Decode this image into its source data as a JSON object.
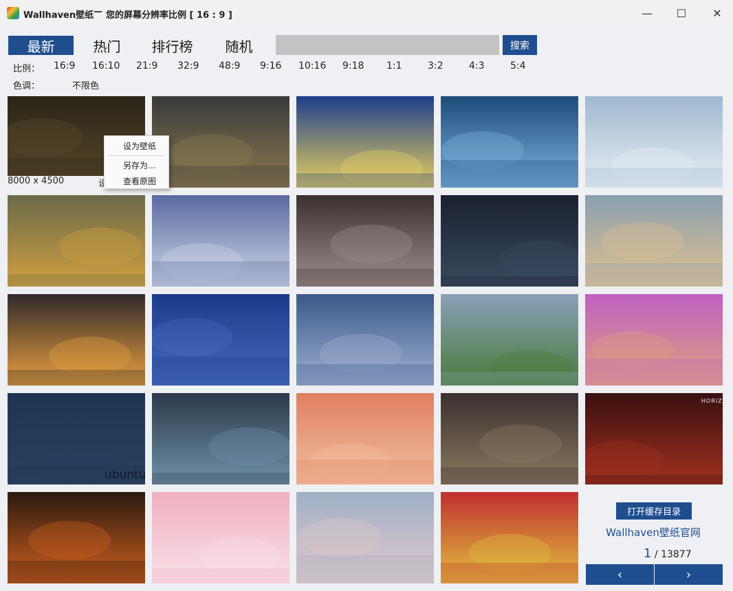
{
  "window": {
    "app_name": "Wallhaven壁纸",
    "separator": "—",
    "subtitle": "您的屏幕分辨率比例 [ 16 : 9 ]",
    "minimize_glyph": "—",
    "maximize_glyph": "☐",
    "close_glyph": "✕"
  },
  "nav": {
    "tabs": [
      {
        "label": "最新",
        "active": true
      },
      {
        "label": "热门",
        "active": false
      },
      {
        "label": "排行榜",
        "active": false
      },
      {
        "label": "随机",
        "active": false
      }
    ]
  },
  "search": {
    "placeholder": "",
    "button_label": "搜索"
  },
  "filters": {
    "ratio_label": "比例：",
    "ratios": [
      "16:9",
      "16:10",
      "21:9",
      "32:9",
      "48:9",
      "9:16",
      "10:16",
      "9:18",
      "1:1",
      "3:2",
      "4:3",
      "5:4"
    ],
    "color_label": "色调：",
    "color_value": "不限色"
  },
  "thumbnails": [
    {
      "name": "dark-warriors",
      "colors": [
        "#2a2418",
        "#5a4a2a"
      ]
    },
    {
      "name": "sunset-clouds",
      "colors": [
        "#3a3a3a",
        "#8a7a50"
      ]
    },
    {
      "name": "starry-wave",
      "colors": [
        "#1d3f8a",
        "#e8d060"
      ]
    },
    {
      "name": "car-snow-road",
      "colors": [
        "#1c4b7a",
        "#7fb4e0"
      ]
    },
    {
      "name": "car-snow-forest",
      "colors": [
        "#9fb8d0",
        "#e8eef4"
      ]
    },
    {
      "name": "car-autumn-road",
      "colors": [
        "#6a6a4a",
        "#d0a040"
      ]
    },
    {
      "name": "anime-girls",
      "colors": [
        "#5a6aa0",
        "#d0d8e8"
      ]
    },
    {
      "name": "collage-photos",
      "colors": [
        "#3a3030",
        "#a09090"
      ]
    },
    {
      "name": "dark-lake-night",
      "colors": [
        "#1a2030",
        "#3a4a60"
      ]
    },
    {
      "name": "mountain-lake-ship",
      "colors": [
        "#8aa0b0",
        "#e0c090"
      ]
    },
    {
      "name": "sunset-lake",
      "colors": [
        "#302a2a",
        "#e8a040"
      ]
    },
    {
      "name": "night-harbor-town",
      "colors": [
        "#1a3a8a",
        "#4a6ac0"
      ]
    },
    {
      "name": "lake-town-dusk",
      "colors": [
        "#3a5a8a",
        "#a0b0d0"
      ]
    },
    {
      "name": "wind-turbines",
      "colors": [
        "#8aa0b8",
        "#4a7a3a"
      ]
    },
    {
      "name": "purple-hair-girl",
      "colors": [
        "#c060c0",
        "#e0a080"
      ]
    },
    {
      "name": "ubuntu-dark",
      "colors": [
        "#1e3450",
        "#2a4060"
      ]
    },
    {
      "name": "clouds-horizon",
      "colors": [
        "#2a3a4a",
        "#7090a8"
      ]
    },
    {
      "name": "red-hair-girl-art",
      "colors": [
        "#e08060",
        "#f0c0a0"
      ]
    },
    {
      "name": "woman-game-character",
      "colors": [
        "#3a3030",
        "#8a7a60"
      ]
    },
    {
      "name": "horizon-zero-dawn",
      "colors": [
        "#3a1010",
        "#a03020"
      ]
    },
    {
      "name": "fire-warrior",
      "colors": [
        "#2a1a10",
        "#d06020"
      ]
    },
    {
      "name": "pink-hair-anime",
      "colors": [
        "#f0b0c0",
        "#f8e0e8"
      ]
    },
    {
      "name": "street-lamp-birds",
      "colors": [
        "#a0b0c8",
        "#e0c8c8"
      ]
    },
    {
      "name": "colorful-characters",
      "colors": [
        "#c03030",
        "#e0c040"
      ]
    }
  ],
  "thumbnail_texts": {
    "ubuntu": "ubuntu",
    "horizon": "HORIZON"
  },
  "context_menu": {
    "items": [
      "设为壁纸",
      "另存为...",
      "查看原图"
    ]
  },
  "hover_info": {
    "size": "8000 x 4500",
    "truncated": "设"
  },
  "sidebar": {
    "cache_button": "打开缓存目录",
    "site_link": "Wallhaven壁纸官网",
    "page_current": "1",
    "page_total": "/ 13877",
    "prev_glyph": "‹",
    "next_glyph": "›"
  }
}
